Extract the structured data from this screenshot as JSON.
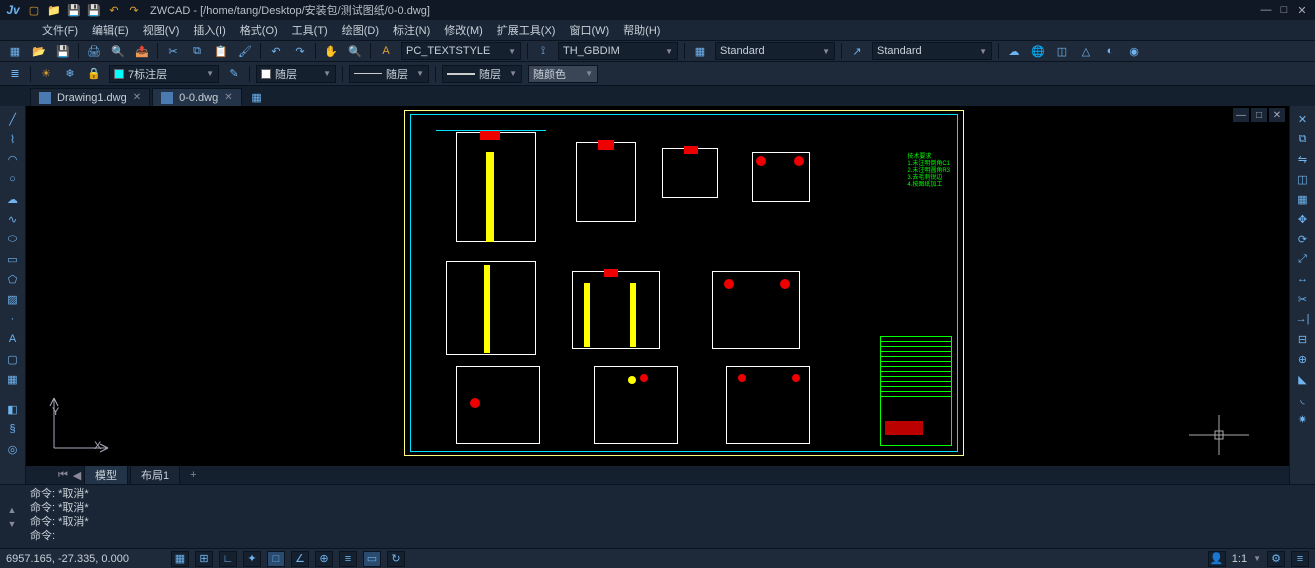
{
  "app": {
    "name": "ZWCAD",
    "title": "ZWCAD -  [/home/tang/Desktop/安装包/测试图纸/0-0.dwg]"
  },
  "menu": {
    "items": [
      "文件(F)",
      "编辑(E)",
      "视图(V)",
      "插入(I)",
      "格式(O)",
      "工具(T)",
      "绘图(D)",
      "标注(N)",
      "修改(M)",
      "扩展工具(X)",
      "窗口(W)",
      "帮助(H)"
    ]
  },
  "ribbon": {
    "textstyle": "PC_TEXTSTYLE",
    "dimstyle": "TH_GBDIM",
    "tablestyle": "Standard",
    "mleader": "Standard"
  },
  "layer": {
    "current": "7标注层",
    "bylayer1": "随层",
    "bylayer2": "随层",
    "bylayer3": "随层",
    "color_label": "随颜色"
  },
  "tabs": {
    "docs": [
      {
        "name": "Drawing1.dwg",
        "active": false
      },
      {
        "name": "0-0.dwg",
        "active": true
      }
    ]
  },
  "layout": {
    "tabs": [
      "模型",
      "布局1"
    ],
    "add": "+"
  },
  "command": {
    "history": [
      "命令: *取消*",
      "命令: *取消*",
      "命令: *取消*"
    ],
    "prompt": "命令:"
  },
  "status": {
    "coords": "6957.165, -27.335, 0.000",
    "scale": "1:1"
  },
  "axes": {
    "x": "X",
    "y": "Y"
  },
  "notes": "技术要求\n1.未注明倒角C1\n2.未注明圆角R3\n3.去毛刺锐边\n4.按图纸加工"
}
